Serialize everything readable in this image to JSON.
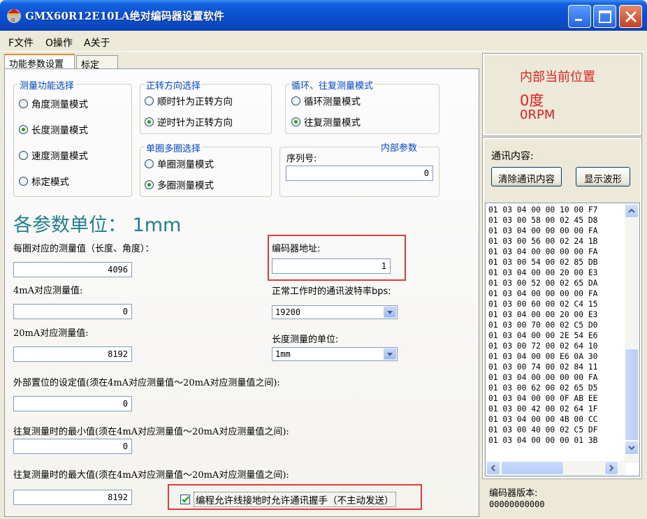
{
  "window": {
    "title": "GMX60R12E10LA绝对编码器设置软件"
  },
  "menu": {
    "file": "F文件",
    "operate": "O操作",
    "about": "A关于"
  },
  "tabs": {
    "func": "功能参数设置",
    "calib": "标定"
  },
  "measure_func": {
    "title": "测量功能选择",
    "options": [
      "角度测量模式",
      "长度测量模式",
      "速度测量模式",
      "标定模式"
    ],
    "selected": 1
  },
  "direction": {
    "title": "正转方向选择",
    "options": [
      "顺时针为正转方向",
      "逆时针为正转方向"
    ],
    "selected": 1
  },
  "cycle": {
    "title": "循环、往复测量模式",
    "options": [
      "循环测量模式",
      "往复测量模式"
    ],
    "selected": 1
  },
  "turns": {
    "title": "单圈多圈选择",
    "options": [
      "单圈测量模式",
      "多圈测量模式"
    ],
    "selected": 1
  },
  "internal": {
    "title": "内部参数",
    "serial_label": "序列号:",
    "serial_value": "0"
  },
  "units_title": "各参数单位：  1mm",
  "params": {
    "per_turn_label": "每圈对应的测量值（长度、角度）：",
    "per_turn_value": "4096",
    "ma4_label": "4mA对应测量值:",
    "ma4_value": "0",
    "ma20_label": "20mA对应测量值:",
    "ma20_value": "8192",
    "ext_label": "外部置位的设定值(须在4mA对应测量值～20mA对应测量值之间):",
    "ext_value": "0",
    "min_label": "往复测量时的最小值(须在4mA对应测量值～20mA对应测量值之间):",
    "min_value": "0",
    "max_label": "往复测量时的最大值(须在4mA对应测量值～20mA对应测量值之间):",
    "max_value": "8192"
  },
  "encoder_addr": {
    "label": "编码器地址:",
    "value": "1"
  },
  "baud": {
    "label": "正常工作时的通讯波特率bps:",
    "value": "19200"
  },
  "len_unit": {
    "label": "长度测量的单位:",
    "value": "1mm"
  },
  "handshake": {
    "label": "编程允许线接地时允许通讯握手（不主动发送）",
    "checked": true
  },
  "position": {
    "title": "内部当前位置",
    "degree": "0度",
    "rpm": "0RPM"
  },
  "comm": {
    "title": "通讯内容:",
    "clear_btn": "清除通讯内容",
    "wave_btn": "显示波形",
    "lines": [
      "01 03 04 00 00 10 00 F7",
      "01 03 00 58 00 02 45 D8",
      "01 03 04 00 00 00 00 FA",
      "01 03 00 56 00 02 24 1B",
      "01 03 04 00 00 00 00 FA",
      "01 03 00 54 00 02 85 DB",
      "01 03 04 00 00 20 00 E3",
      "01 03 00 52 00 02 65 DA",
      "01 03 04 00 00 00 00 FA",
      "01 03 00 60 00 02 C4 15",
      "01 03 04 00 00 20 00 E3",
      "01 03 00 70 00 02 C5 D0",
      "01 03 04 00 00 2E 54 E6",
      "01 03 00 72 00 02 64 10",
      "01 03 04 00 00 E6 0A 30",
      "01 03 00 74 00 02 84 11",
      "01 03 04 00 00 00 00 FA",
      "01 03 00 62 00 02 65 D5",
      "01 03 04 00 00 0F AB EE",
      "01 03 00 42 00 02 64 1F",
      "01 03 04 00 00 4B 00 CC",
      "01 03 00 40 00 02 C5 DF",
      "01 03 04 00 00 00 01 3B"
    ]
  },
  "version": {
    "label": "编码器版本:",
    "value": "00000000000"
  },
  "colors": {
    "accent_red": "#e02020",
    "title_teal": "#1f7f8f",
    "group_blue": "#0046d5"
  }
}
